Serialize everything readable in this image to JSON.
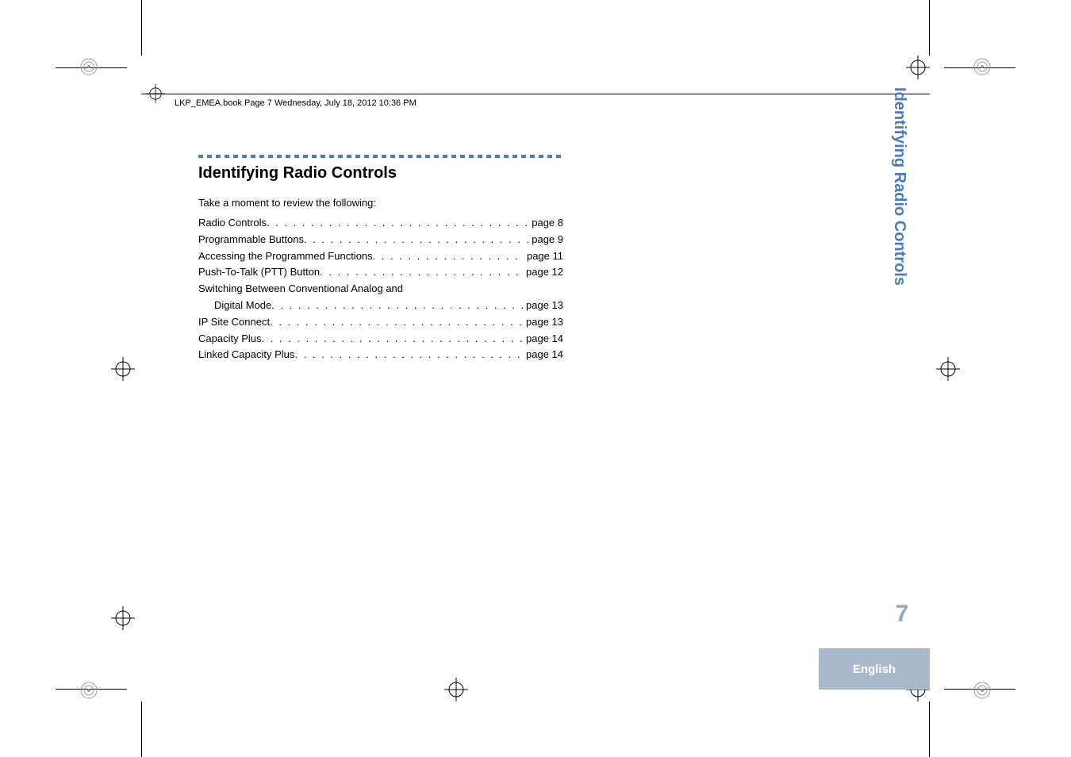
{
  "header": {
    "running_header": "LKP_EMEA.book  Page 7  Wednesday, July 18, 2012  10:36 PM"
  },
  "section": {
    "title": "Identifying Radio Controls",
    "intro": "Take a moment to review the following:"
  },
  "toc": [
    {
      "label": "Radio Controls",
      "page": "page 8",
      "indent": false
    },
    {
      "label": "Programmable Buttons",
      "page": "page 9",
      "indent": false
    },
    {
      "label": "Accessing the Programmed Functions",
      "page": "page 11",
      "indent": false
    },
    {
      "label": "Push-To-Talk (PTT) Button",
      "page": "page 12",
      "indent": false
    },
    {
      "label": "Switching Between Conventional Analog and",
      "page": "",
      "indent": false,
      "no_dots": true
    },
    {
      "label": "Digital Mode",
      "page": "page 13",
      "indent": true
    },
    {
      "label": "IP Site Connect",
      "page": "page 13",
      "indent": false
    },
    {
      "label": "Capacity Plus",
      "page": "page 14",
      "indent": false
    },
    {
      "label": "Linked Capacity Plus",
      "page": "page 14",
      "indent": false
    }
  ],
  "sidebar": {
    "title": "Identifying Radio Controls",
    "page_number": "7",
    "language": "English"
  }
}
